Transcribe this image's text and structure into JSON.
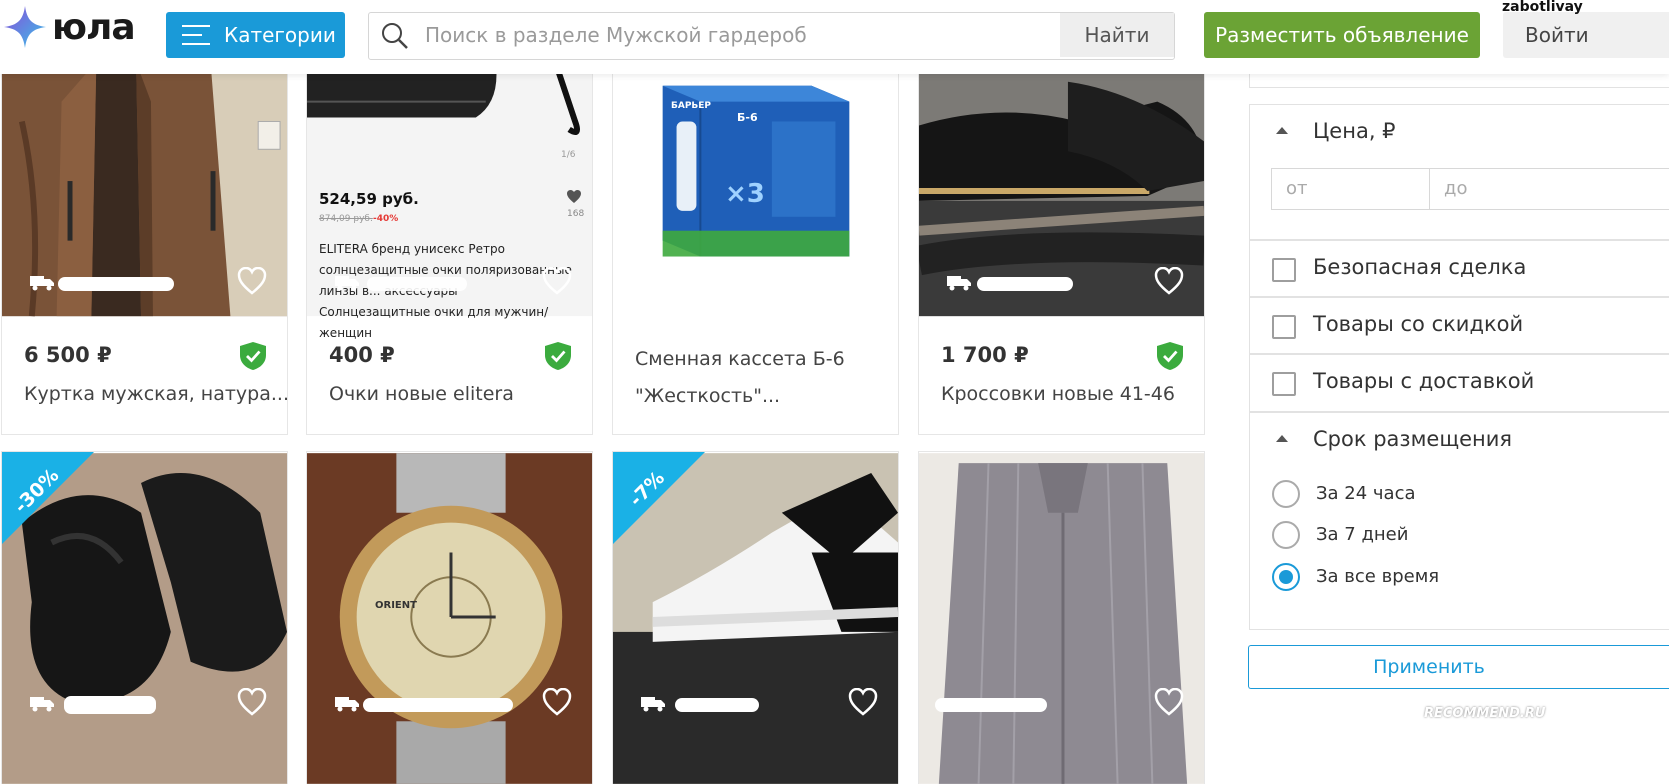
{
  "header": {
    "logo_text": "юла",
    "categories_label": "Категории",
    "search_placeholder": "Поиск в разделе Мужской гардероб",
    "find_label": "Найти",
    "post_ad_label": "Разместить объявление",
    "login_label": "Войти",
    "username": "zabotlivay"
  },
  "cards": [
    {
      "price": "6 500 ₽",
      "title": "Куртка мужская, натура...",
      "verified": true
    },
    {
      "price": "400 ₽",
      "title": "Очки новые elitera",
      "verified": true,
      "promo": {
        "price": "524,59 руб.",
        "old_price": "874,09 руб.",
        "discount": "-40%",
        "likes": "168",
        "page": "1/6",
        "description": [
          "ELITERA бренд унисекс Ретро",
          "солнцезащитные очки поляризованные",
          "линзы в...               аксессуары",
          "Солнцезащитные очки для мужчин/женщин"
        ]
      }
    },
    {
      "title_line1": "Сменная кассета Б-6",
      "title_line2": "\"Жесткость\"...",
      "box_brand": "БАРЬЕР",
      "box_text": "Б-6",
      "box_count": "×3"
    },
    {
      "price": "1 700 ₽",
      "title": "Кроссовки новые 41-46",
      "verified": true
    },
    {
      "discount": "-30%"
    },
    {
      "watch_brand": "ORIENT"
    },
    {
      "discount": "-7%"
    },
    {}
  ],
  "sidebar": {
    "price_title": "Цена, ₽",
    "price_from_placeholder": "от",
    "price_to_placeholder": "до",
    "checkboxes": [
      "Безопасная сделка",
      "Товары со скидкой",
      "Товары с доставкой"
    ],
    "period_title": "Срок размещения",
    "periods": [
      "За 24 часа",
      "За 7 дней",
      "За все время"
    ],
    "selected_period": "За все время",
    "apply_label": "Применить"
  },
  "watermark": "RECOMMEND.RU",
  "colors": {
    "accent_blue": "#1a9ad8",
    "accent_green": "#6ba335",
    "verified_green": "#3bab3e",
    "discount_badge": "#1ab1e6"
  }
}
